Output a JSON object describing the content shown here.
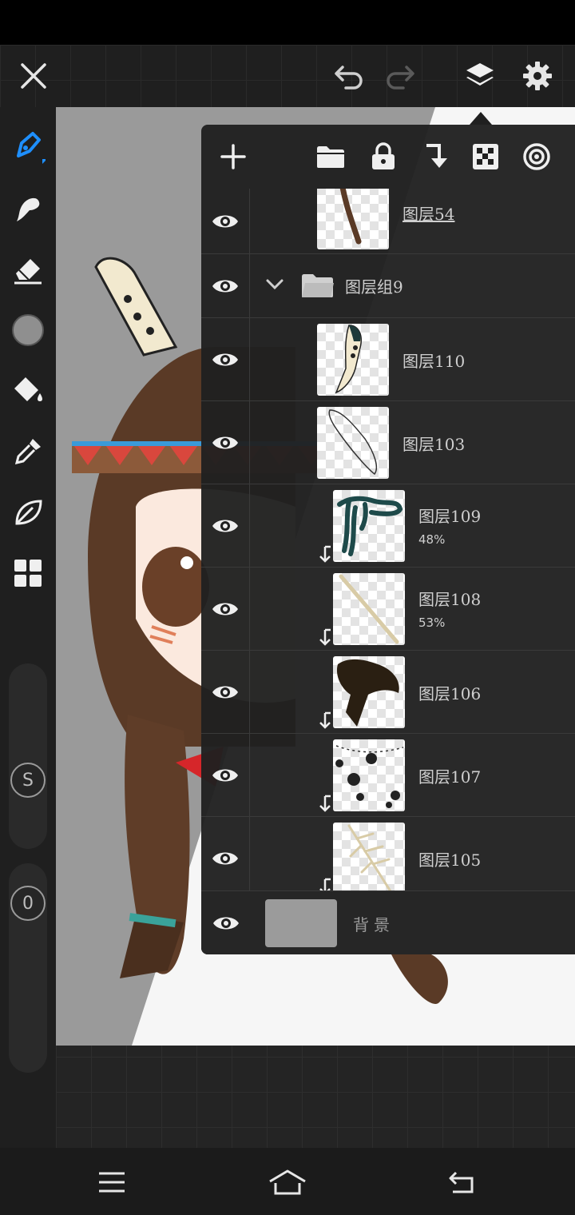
{
  "app": {
    "accent_color": "#1e8fff",
    "icons": {
      "close": "close-icon",
      "undo": "undo-icon",
      "redo": "redo-icon",
      "layers": "layers-icon",
      "settings": "gear-icon"
    }
  },
  "left_toolbar": {
    "tools": [
      "brush-icon",
      "smudge-icon",
      "eraser-icon",
      "color-swatch",
      "fill-bucket-icon",
      "eyedropper-icon",
      "leaf-icon",
      "grid-icon"
    ],
    "size_label": "S",
    "opacity_label": "0"
  },
  "layer_panel": {
    "toolbar": [
      "add-layer-icon",
      "folder-icon",
      "lock-icon",
      "merge-down-icon",
      "transparency-icon",
      "target-icon"
    ],
    "layers": [
      {
        "name": "图层54",
        "opacity": "",
        "clipped": false
      },
      {
        "name": "图层组9",
        "opacity": "",
        "clipped": false,
        "is_group": true
      },
      {
        "name": "图层110",
        "opacity": "",
        "clipped": false
      },
      {
        "name": "图层103",
        "opacity": "",
        "clipped": false
      },
      {
        "name": "图层109",
        "opacity": "48%",
        "clipped": true
      },
      {
        "name": "图层108",
        "opacity": "53%",
        "clipped": true
      },
      {
        "name": "图层106",
        "opacity": "",
        "clipped": true
      },
      {
        "name": "图层107",
        "opacity": "",
        "clipped": true
      },
      {
        "name": "图层105",
        "opacity": "",
        "clipped": true
      }
    ],
    "background_layer": {
      "name": "背景",
      "color": "#9b9b9b"
    }
  },
  "bottom_nav": [
    "menu-icon",
    "home-icon",
    "back-icon"
  ]
}
